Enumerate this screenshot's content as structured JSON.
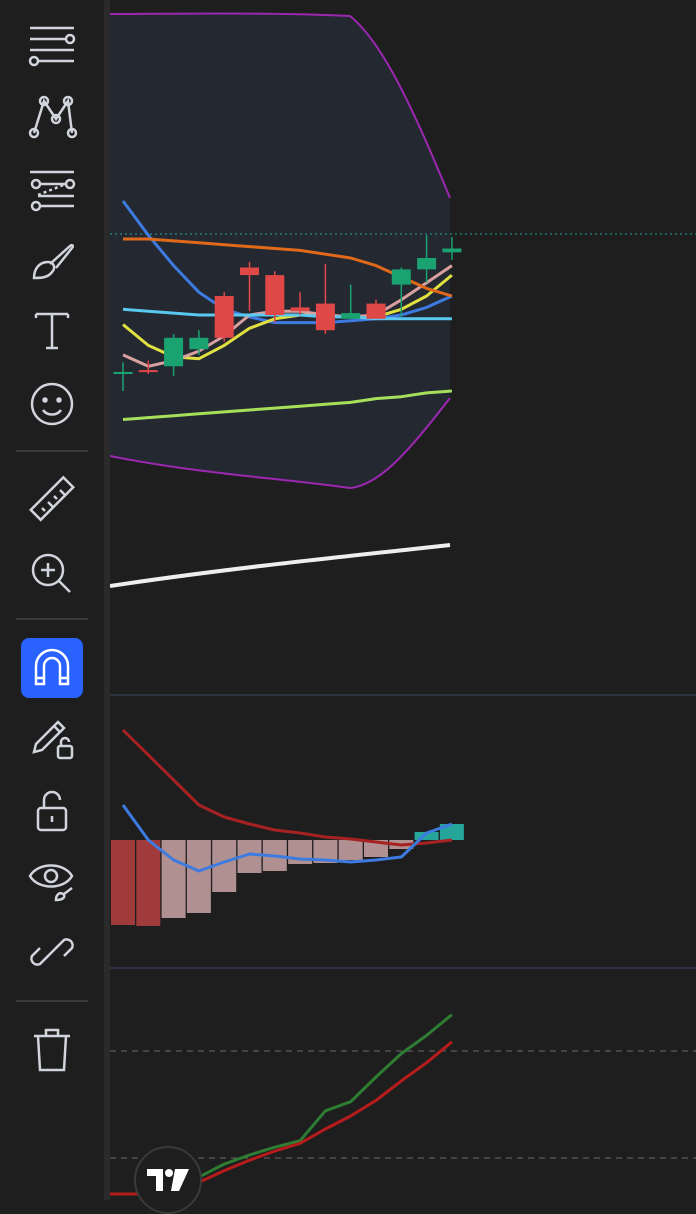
{
  "toolbar": {
    "tools": [
      {
        "name": "cursor-tools",
        "icon": "crosshair-lines-icon",
        "active": false
      },
      {
        "name": "trend-line-tools",
        "icon": "pattern-icon",
        "active": false
      },
      {
        "name": "fib-tools",
        "icon": "fib-lines-icon",
        "active": false
      },
      {
        "name": "brush-tools",
        "icon": "brush-icon",
        "active": false
      },
      {
        "name": "text-tools",
        "icon": "text-icon",
        "active": false
      },
      {
        "name": "emoji-tools",
        "icon": "smiley-icon",
        "active": false
      },
      {
        "name": "measure",
        "icon": "ruler-icon",
        "active": false
      },
      {
        "name": "zoom-in",
        "icon": "zoom-in-icon",
        "active": false
      },
      {
        "name": "magnet-mode",
        "icon": "magnet-icon",
        "active": true
      },
      {
        "name": "lock-drawing-mode",
        "icon": "pencil-lock-icon",
        "active": false
      },
      {
        "name": "lock-all-drawings",
        "icon": "unlock-icon",
        "active": false
      },
      {
        "name": "hide-drawings",
        "icon": "eye-brush-icon",
        "active": false
      },
      {
        "name": "sync-drawings",
        "icon": "link-icon",
        "active": false
      },
      {
        "name": "remove-drawings",
        "icon": "trash-icon",
        "active": false
      }
    ],
    "active_color": "#2962ff",
    "icon_color": "#d1d4dc"
  },
  "chart_data": [
    {
      "type": "candlestick",
      "pane": "price",
      "candles": [
        {
          "open": 0.0,
          "close": 0.0,
          "high": 0.5,
          "low": -1.0
        },
        {
          "open": 0.1,
          "close": 0.0,
          "high": 0.6,
          "low": -0.1
        },
        {
          "open": 0.3,
          "close": 1.8,
          "high": 2.0,
          "low": -0.2
        },
        {
          "open": 1.2,
          "close": 1.8,
          "high": 2.2,
          "low": 0.9
        },
        {
          "open": 4.0,
          "close": 1.8,
          "high": 4.2,
          "low": 1.6
        },
        {
          "open": 5.5,
          "close": 5.1,
          "high": 5.8,
          "low": 3.2
        },
        {
          "open": 5.1,
          "close": 3.0,
          "high": 5.3,
          "low": 2.6
        },
        {
          "open": 3.4,
          "close": 3.2,
          "high": 4.2,
          "low": 3.0
        },
        {
          "open": 3.6,
          "close": 2.2,
          "high": 5.7,
          "low": 2.0
        },
        {
          "open": 2.8,
          "close": 3.1,
          "high": 4.6,
          "low": 2.8
        },
        {
          "open": 3.6,
          "close": 2.8,
          "high": 3.8,
          "low": 2.8
        },
        {
          "open": 4.6,
          "close": 5.4,
          "high": 5.5,
          "low": 2.9
        },
        {
          "open": 5.4,
          "close": 6.0,
          "high": 7.2,
          "low": 4.7
        },
        {
          "open": 6.3,
          "close": 6.5,
          "high": 7.1,
          "low": 5.9
        }
      ],
      "overlays": [
        {
          "color": "#3d7be0",
          "values": [
            9.0,
            7.2,
            5.6,
            4.2,
            3.3,
            2.9,
            2.6,
            2.6,
            2.6,
            2.7,
            2.8,
            3.0,
            3.4,
            4.0
          ]
        },
        {
          "color": "#e0e040",
          "values": [
            2.5,
            1.4,
            0.8,
            0.7,
            1.4,
            2.3,
            2.8,
            3.0,
            3.0,
            2.9,
            2.9,
            3.3,
            4.0,
            5.1
          ]
        },
        {
          "color": "#d9a0a0",
          "values": [
            0.9,
            0.3,
            0.6,
            1.1,
            1.9,
            3.0,
            3.2,
            3.2,
            3.0,
            2.9,
            3.0,
            3.8,
            4.7,
            5.6
          ]
        },
        {
          "color": "#5bc8f0",
          "values": [
            3.3,
            3.2,
            3.1,
            3.0,
            3.0,
            3.0,
            3.0,
            3.0,
            2.9,
            2.9,
            2.8,
            2.8,
            2.8,
            2.8
          ]
        },
        {
          "color": "#e06a1a",
          "values": [
            7.0,
            7.0,
            6.9,
            6.8,
            6.7,
            6.6,
            6.5,
            6.4,
            6.2,
            6.0,
            5.6,
            5.0,
            4.4,
            4.0
          ]
        },
        {
          "color": "#a6e05a",
          "values": [
            -2.5,
            -2.4,
            -2.3,
            -2.2,
            -2.1,
            -2.0,
            -1.9,
            -1.8,
            -1.7,
            -1.6,
            -1.4,
            -1.3,
            -1.1,
            -1.0
          ]
        }
      ],
      "last_price_color": "#26a69a"
    },
    {
      "type": "histogram",
      "pane": "oscillator",
      "values": [
        -8.5,
        -8.6,
        -7.8,
        -7.3,
        -5.2,
        -3.3,
        -3.1,
        -2.4,
        -2.3,
        -2.0,
        -1.7,
        -0.9,
        0.8,
        1.6
      ],
      "lines": [
        {
          "color": "#a62222",
          "values": [
            11.0,
            8.5,
            6.0,
            3.5,
            2.3,
            1.6,
            1.0,
            0.7,
            0.3,
            0.1,
            -0.2,
            -0.5,
            -0.3,
            0.0
          ]
        },
        {
          "color": "#3d7be0",
          "values": [
            3.5,
            0.0,
            -2.0,
            -3.1,
            -2.2,
            -1.4,
            -1.6,
            -1.9,
            -2.0,
            -2.2,
            -2.0,
            -1.7,
            0.7,
            1.6
          ]
        }
      ]
    },
    {
      "type": "line",
      "pane": "lower",
      "series": [
        {
          "color": "#2e7d32",
          "values": [
            0.0,
            0.0,
            0.3,
            1.3,
            2.3,
            3.0,
            3.6,
            4.1,
            6.4,
            7.1,
            9.0,
            10.8,
            12.2,
            13.8
          ]
        },
        {
          "color": "#b71c1c",
          "values": [
            0.0,
            0.0,
            0.0,
            0.9,
            1.8,
            2.6,
            3.3,
            3.9,
            5.0,
            6.0,
            7.2,
            8.7,
            10.1,
            11.7
          ]
        }
      ]
    }
  ]
}
